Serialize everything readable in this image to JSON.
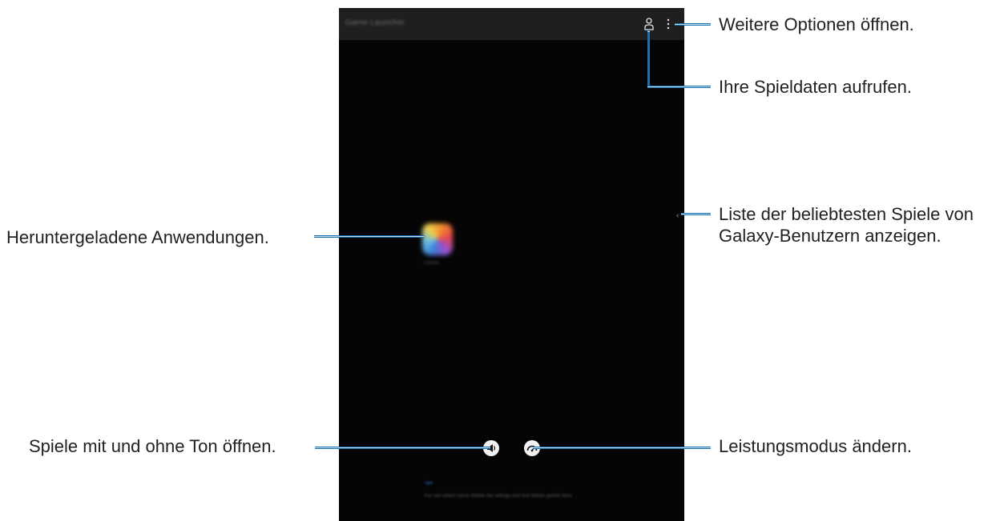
{
  "screen": {
    "app_title": "Game Launcher",
    "app_label": "Games",
    "chevron": "‹",
    "info_title": "Tips",
    "info_text": "You can select Game Mobile the settings and find Mobile games here."
  },
  "callouts": {
    "more_options": "Weitere Optionen öffnen.",
    "game_data": "Ihre Spieldaten aufrufen.",
    "downloaded_apps": "Heruntergeladene Anwendungen.",
    "popular_games_line1": "Liste der beliebtesten Spiele von",
    "popular_games_line2": "Galaxy-Benutzern anzeigen.",
    "sound": "Spiele mit und ohne Ton öffnen.",
    "performance": "Leistungsmodus ändern."
  },
  "colors": {
    "callout_line": "#1d6fae",
    "screen_bg": "#050505",
    "appbar_bg": "#1f1f1f"
  },
  "icons": [
    "profile-icon",
    "more-options-icon",
    "app-icon",
    "chevron-left-icon",
    "sound-icon",
    "performance-icon"
  ]
}
